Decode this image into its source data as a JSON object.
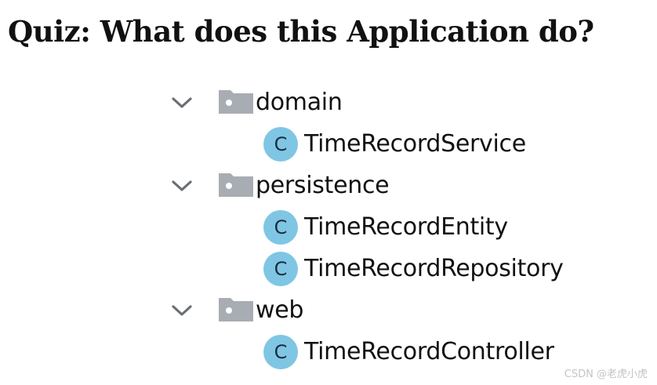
{
  "title": "Quiz: What does this Application do?",
  "tree": {
    "packages": [
      {
        "name": "domain",
        "expanded": true,
        "classes": [
          "TimeRecordService"
        ]
      },
      {
        "name": "persistence",
        "expanded": true,
        "classes": [
          "TimeRecordEntity",
          "TimeRecordRepository"
        ]
      },
      {
        "name": "web",
        "expanded": true,
        "classes": [
          "TimeRecordController"
        ]
      }
    ],
    "class_icon_letter": "C",
    "icons": {
      "expand": "chevron-down-icon",
      "package": "folder-icon",
      "class": "class-icon"
    },
    "colors": {
      "folder": "#a8adb3",
      "class_badge": "#7fc6e4"
    }
  },
  "watermark": "CSDN @老虎小虎"
}
